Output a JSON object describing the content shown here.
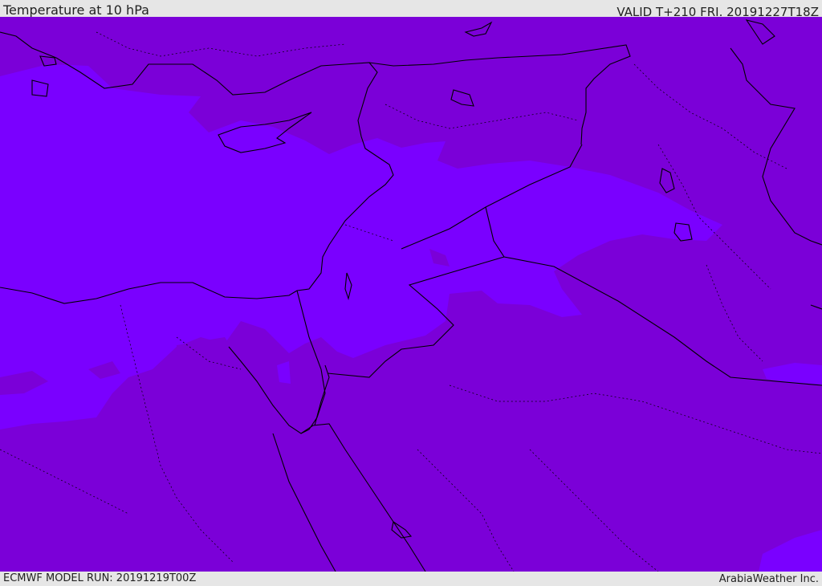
{
  "header": {
    "title": "Temperature at 10 hPa",
    "valid": "VALID T+210 FRI. 20191227T18Z"
  },
  "footer": {
    "model_run": "ECMWF MODEL RUN: 20191219T00Z",
    "brand": "ArabiaWeather Inc."
  },
  "map": {
    "colors": {
      "background": "#7b00d8",
      "warm_band": "#7a00ff",
      "coastline": "#000000"
    }
  }
}
